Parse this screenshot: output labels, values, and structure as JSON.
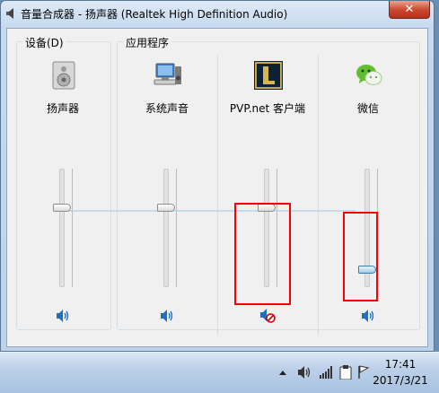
{
  "window": {
    "title": "音量合成器 - 扬声器 (Realtek High Definition Audio)",
    "close_label": "✕"
  },
  "groups": {
    "device_label": "设备(D)",
    "apps_label": "应用程序"
  },
  "channels": [
    {
      "label": "扬声器",
      "icon": "speaker-device-icon",
      "level": 0.68,
      "muted": false
    },
    {
      "label": "系统声音",
      "icon": "system-sounds-icon",
      "level": 0.68,
      "muted": false
    },
    {
      "label": "PVP.net 客户端",
      "icon": "league-of-legends-icon",
      "level": 0.68,
      "muted": true
    },
    {
      "label": "微信",
      "icon": "wechat-icon",
      "level": 0.12,
      "muted": false
    }
  ],
  "taskbar": {
    "time": "17:41",
    "date": "2017/3/21",
    "tray_icons": [
      "show-hidden-icons-arrow",
      "volume-icon",
      "network-signal-icon",
      "clipboard-icon",
      "flag-icon"
    ]
  },
  "colors": {
    "highlight": "#ff0000",
    "accent": "#1f6fbf"
  }
}
